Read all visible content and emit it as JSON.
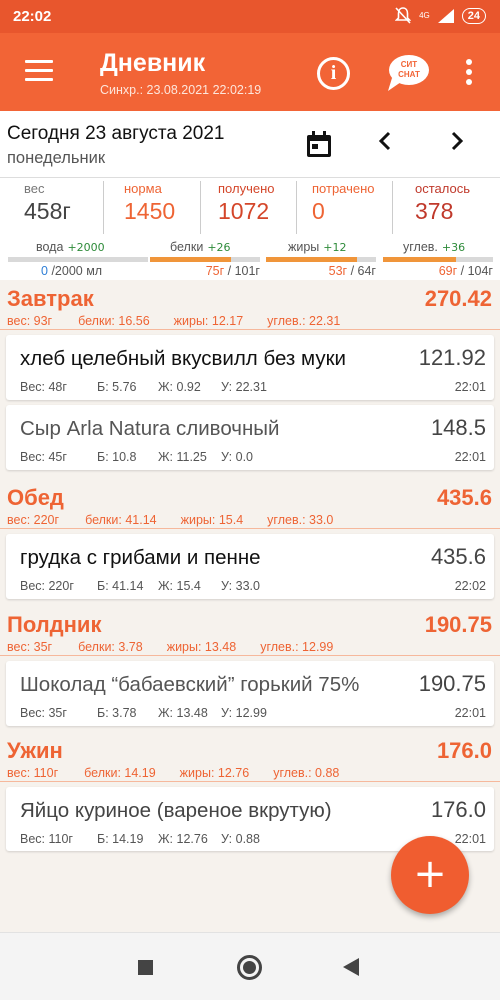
{
  "status": {
    "time": "22:02",
    "network": "4G",
    "battery": "24"
  },
  "appbar": {
    "title": "Дневник",
    "sync": "Синхр.: 23.08.2021 22:02:19",
    "brand_line1": "СИТ",
    "brand_line2": "СНАТ"
  },
  "date": {
    "label": "Сегодня 23 августа 2021",
    "weekday": "понедельник"
  },
  "summary": {
    "weight_label": "вес",
    "weight": "458г",
    "norm_label": "норма",
    "norm": "1450",
    "received_label": "получено",
    "received": "1072",
    "spent_label": "потрачено",
    "spent": "0",
    "left_label": "осталось",
    "left": "378",
    "colors": {
      "norm": "#ee6434",
      "received": "#d4462a",
      "spent": "#ee6434",
      "left": "#c0392b"
    }
  },
  "macros": {
    "water": {
      "label": "вода",
      "delta": "+2000",
      "current": "0",
      "total": "/2000 мл",
      "fill": 0
    },
    "protein": {
      "label": "белки",
      "delta": "+26",
      "current": "75г",
      "total": " / 101г",
      "fill": 0.74
    },
    "fat": {
      "label": "жиры",
      "delta": "+12",
      "current": "53г",
      "total": " / 64г",
      "fill": 0.83
    },
    "carbs": {
      "label": "углев.",
      "delta": "+36",
      "current": "69г",
      "total": " / 104г",
      "fill": 0.66
    }
  },
  "meals": [
    {
      "name": "Завтрак",
      "kcal": "270.42",
      "weight": "вес: 93г",
      "protein": "белки: 16.56",
      "fat": "жиры: 12.17",
      "carbs": "углев.: 22.31",
      "items": [
        {
          "name": "хлеб целебный вкусвилл без муки",
          "kcal": "121.92",
          "weight": "Вес: 48г",
          "p": "Б: 5.76",
          "f": "Ж: 0.92",
          "c": "У: 22.31",
          "time": "22:01"
        },
        {
          "name": "Сыр Arla Natura сливочный",
          "kcal": "148.5",
          "weight": "Вес: 45г",
          "p": "Б: 10.8",
          "f": "Ж: 11.25",
          "c": "У: 0.0",
          "time": "22:01"
        }
      ]
    },
    {
      "name": "Обед",
      "kcal": "435.6",
      "weight": "вес: 220г",
      "protein": "белки: 41.14",
      "fat": "жиры: 15.4",
      "carbs": "углев.: 33.0",
      "items": [
        {
          "name": "грудка с грибами и пенне",
          "kcal": "435.6",
          "weight": "Вес: 220г",
          "p": "Б: 41.14",
          "f": "Ж: 15.4",
          "c": "У: 33.0",
          "time": "22:02"
        }
      ]
    },
    {
      "name": "Полдник",
      "kcal": "190.75",
      "weight": "вес: 35г",
      "protein": "белки: 3.78",
      "fat": "жиры: 13.48",
      "carbs": "углев.: 12.99",
      "items": [
        {
          "name": "Шоколад “бабаевский” горький 75%",
          "kcal": "190.75",
          "weight": "Вес: 35г",
          "p": "Б: 3.78",
          "f": "Ж: 13.48",
          "c": "У: 12.99",
          "time": "22:01"
        }
      ]
    },
    {
      "name": "Ужин",
      "kcal": "176.0",
      "weight": "вес: 110г",
      "protein": "белки: 14.19",
      "fat": "жиры: 12.76",
      "carbs": "углев.: 0.88",
      "items": [
        {
          "name": "Яйцо куриное (вареное вкрутую)",
          "kcal": "176.0",
          "weight": "Вес: 110г",
          "p": "Б: 14.19",
          "f": "Ж: 12.76",
          "c": "У: 0.88",
          "time": "22:01"
        }
      ]
    }
  ],
  "fab": {
    "label": "+"
  }
}
